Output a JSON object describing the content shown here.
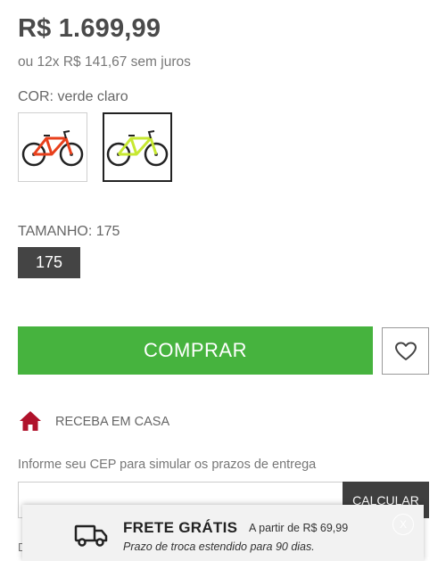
{
  "product": {
    "price": "R$ 1.699,99",
    "installments": "ou 12x R$ 141,67 sem juros"
  },
  "color": {
    "label": "COR: verde claro",
    "options": [
      {
        "name": "vermelho",
        "frame_color": "#e8401c",
        "selected": false
      },
      {
        "name": "verde claro",
        "frame_color": "#c7e832",
        "selected": true
      }
    ]
  },
  "size": {
    "label": "TAMANHO: 175",
    "options": [
      "175"
    ]
  },
  "actions": {
    "buy_label": "COMPRAR",
    "wishlist_icon": "heart-icon"
  },
  "delivery": {
    "icon": "home-icon",
    "title": "RECEBA EM CASA",
    "hint": "Informe seu CEP para simular os prazos de entrega",
    "cep_value": "",
    "calculate_label": "CALCULAR",
    "partial_text": "D"
  },
  "banner": {
    "icon": "truck-icon",
    "title": "FRETE GRÁTIS",
    "subtitle": "A partir de R$ 69,99",
    "description": "Prazo de troca estendido para 90 dias.",
    "close_label": "X"
  },
  "colors": {
    "buy_button": "#46b33e",
    "home_icon": "#b0122b",
    "dark_button": "#444444"
  }
}
